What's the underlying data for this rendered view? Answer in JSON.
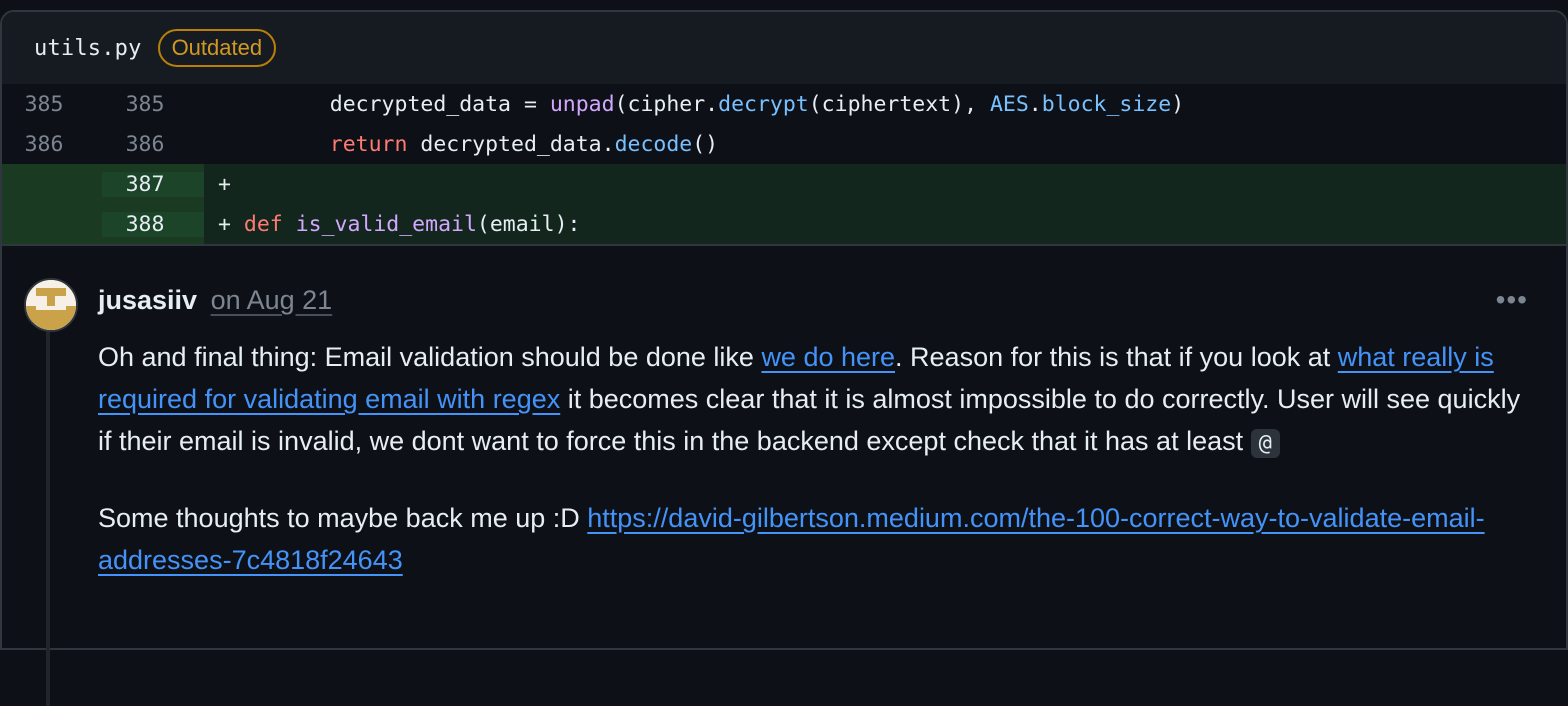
{
  "file": {
    "name": "utils.py",
    "badge": "Outdated"
  },
  "diff": {
    "lines": [
      {
        "old": "385",
        "new": "385"
      },
      {
        "old": "386",
        "new": "386"
      },
      {
        "old": "",
        "new": "387"
      },
      {
        "old": "",
        "new": "388"
      }
    ],
    "tokens": {
      "l385_a": "    decrypted_data = ",
      "l385_unpad": "unpad",
      "l385_b": "(cipher.",
      "l385_decrypt": "decrypt",
      "l385_c": "(ciphertext), ",
      "l385_aes": "AES",
      "l385_d": ".",
      "l385_block": "block_size",
      "l385_e": ")",
      "l386_a": "    ",
      "l386_return": "return",
      "l386_b": " decrypted_data.",
      "l386_decode": "decode",
      "l386_c": "()",
      "l387": "+",
      "l388_plus": "+ ",
      "l388_def": "def",
      "l388_space": " ",
      "l388_fn": "is_valid_email",
      "l388_rest": "(email):"
    }
  },
  "comment": {
    "author": "jusasiiv",
    "date": "on Aug 21",
    "more_icon": "kebab-horizontal",
    "p1": {
      "t1": "Oh and final thing: Email validation should be done like ",
      "link1": "we do here",
      "t2": ". Reason for this is that if you look at ",
      "link2": "what really is required for validating email with regex",
      "t3": " it becomes clear that it is almost impossible to do correctly. User will see quickly if their email is invalid, we dont want to force this in the backend except check that it has at least ",
      "code": "@"
    },
    "p2": {
      "t1": "Some thoughts to maybe back me up :D ",
      "link": "https://david-gilbertson.medium.com/the-100-correct-way-to-validate-email-addresses-7c4818f24643"
    }
  },
  "colors": {
    "background": "#0d1117",
    "added_line": "#12261e",
    "added_gutter": "#1c4428",
    "badge_border": "#bb8009",
    "badge_text": "#d29922",
    "link": "#4493f8"
  }
}
